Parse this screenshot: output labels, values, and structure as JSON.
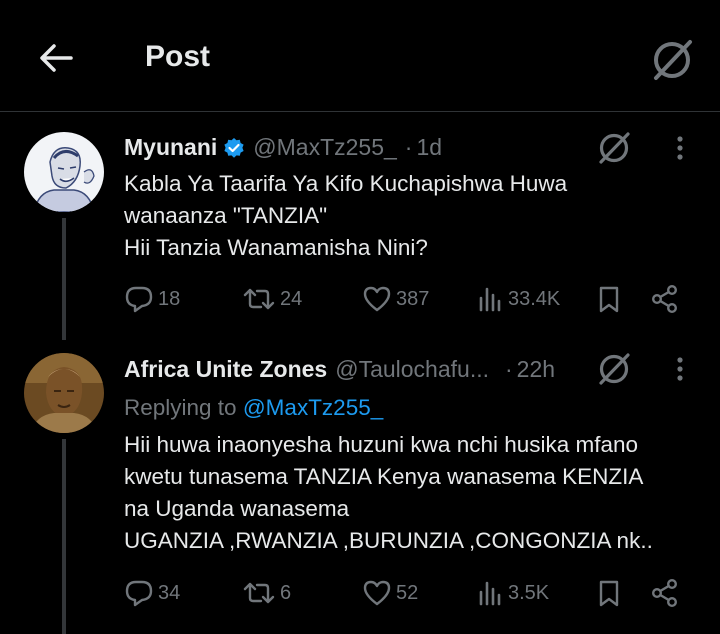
{
  "header": {
    "title": "Post"
  },
  "tweets": [
    {
      "display_name": "Myunani",
      "handle": "@MaxTz255_",
      "time": "1d",
      "verified": true,
      "lines": [
        "Kabla Ya Taarifa Ya Kifo Kuchapishwa Huwa",
        "wanaanza \"TANZIA\"",
        "Hii Tanzia Wanamanisha Nini?"
      ],
      "stats": {
        "replies": "18",
        "reposts": "24",
        "likes": "387",
        "views": "33.4K"
      }
    },
    {
      "display_name": "Africa Unite Zones",
      "handle": "@Taulochafu...",
      "time": "22h",
      "verified": false,
      "replying_prefix": "Replying to",
      "replying_to": "@MaxTz255_",
      "lines": [
        "Hii huwa inaonyesha huzuni kwa nchi husika mfano",
        "kwetu tunasema TANZIA  Kenya wanasema KENZIA",
        "na Uganda wanasema",
        "UGANZIA ,RWANZIA ,BURUNZIA  ,CONGONZIA nk.."
      ],
      "stats": {
        "replies": "34",
        "reposts": "6",
        "likes": "52",
        "views": "3.5K"
      }
    }
  ],
  "icons": {
    "back": "arrow-left-icon",
    "grok": "grok-icon",
    "more": "more-vertical-icon",
    "reply": "reply-icon",
    "repost": "repost-icon",
    "like": "heart-icon",
    "views": "views-chart-icon",
    "bookmark": "bookmark-icon",
    "share": "share-icon",
    "verified": "verified-badge-icon"
  },
  "colors": {
    "background": "#000000",
    "text": "#e7e9ea",
    "muted": "#71767b",
    "accent": "#1d9bf0",
    "divider": "#2f3336"
  }
}
